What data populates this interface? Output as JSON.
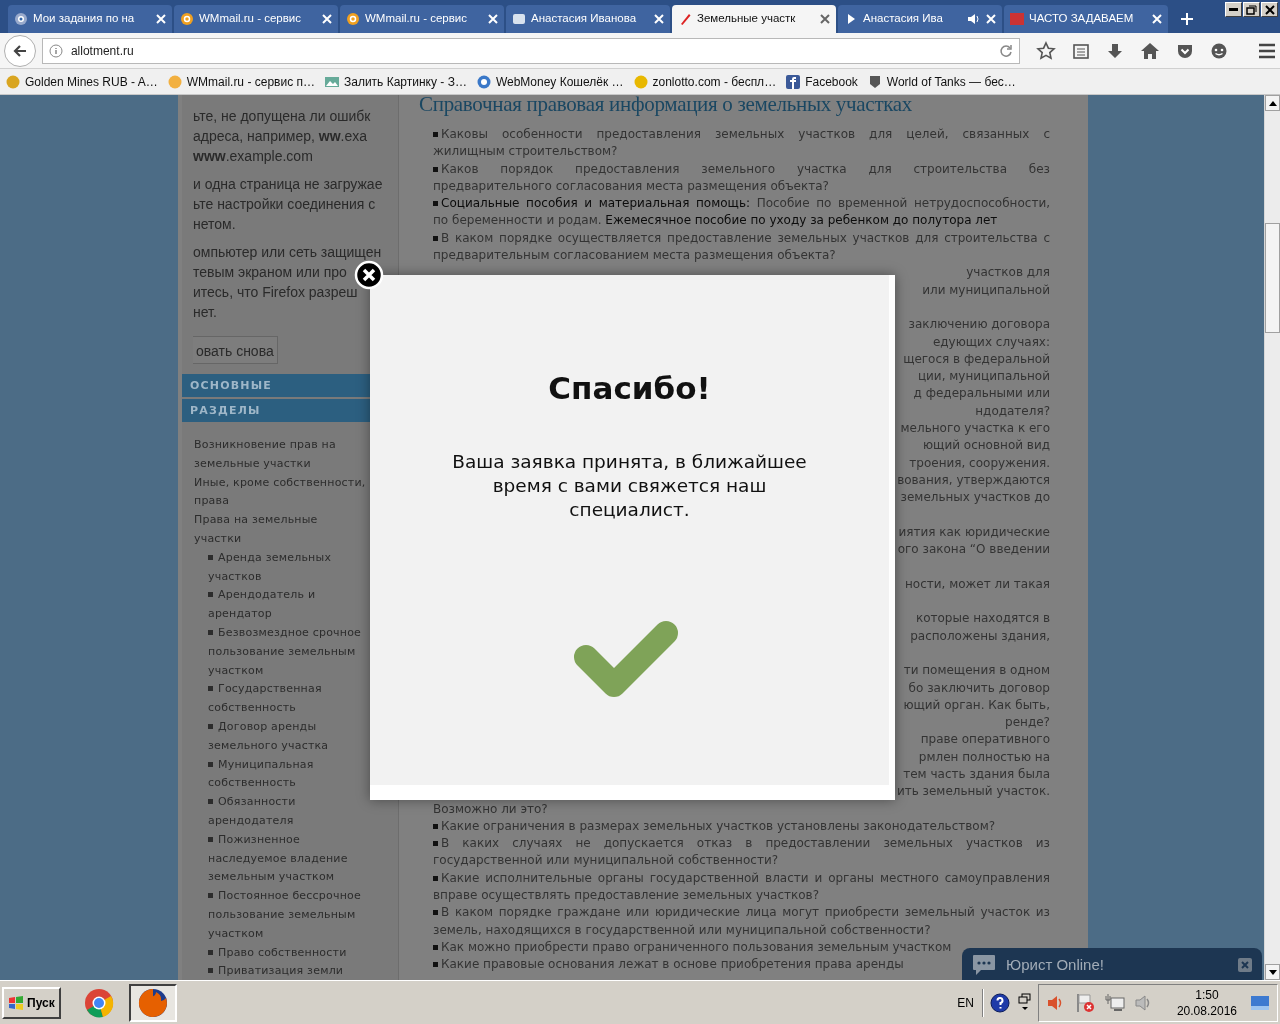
{
  "browser": {
    "tabs": [
      {
        "title": "Мои задания по на",
        "selected": false,
        "audio": false
      },
      {
        "title": "WMmail.ru - сервис",
        "selected": false,
        "audio": false
      },
      {
        "title": "WMmail.ru - сервис",
        "selected": false,
        "audio": false
      },
      {
        "title": "Анастасия Иванова",
        "selected": false,
        "audio": false
      },
      {
        "title": "Земельные участк",
        "selected": true,
        "audio": false
      },
      {
        "title": "Анастасия Ива",
        "selected": false,
        "audio": true
      },
      {
        "title": "ЧАСТО ЗАДАВАЕМ",
        "selected": false,
        "audio": false
      }
    ],
    "address": "allotment.ru",
    "bookmarks": [
      "Golden Mines RUB - A…",
      "WMmail.ru - сервис п…",
      "Залить Картинку - З…",
      "WebMoney Кошелёк …",
      "zonlotto.com - беспл…",
      "Facebook",
      "World of Tanks — бес…"
    ]
  },
  "page": {
    "error_lines": [
      "ьте, не допущена ли ошибк",
      "адреса, например, **ww**.exa",
      "**www**.example.com",
      "и одна страница не загружае",
      "ьте настройки соединения с",
      "нетом.",
      "омпьютер или сеть защищен",
      "тевым экраном или про",
      "итесь, что Firefox разреш",
      "нет."
    ],
    "retry_button": "овать снова",
    "sidebar": {
      "headings": [
        "ОСНОВНЫЕ",
        "РАЗДЕЛЫ"
      ],
      "items": [
        {
          "label": "Возникновение прав на земельные участки"
        },
        {
          "label": "Иные, кроме собственности, права"
        },
        {
          "label": "Права на земельные участки",
          "children": [
            {
              "label": "Аренда земельных участков"
            },
            {
              "label": "Арендодатель и арендатор"
            },
            {
              "label": "Безвозмездное срочное пользование земельным участком"
            },
            {
              "label": "Государственная собственность"
            },
            {
              "label": "Договор аренды земельного участка"
            },
            {
              "label": "Муниципальная собственность"
            },
            {
              "label": "Обязанности арендодателя"
            },
            {
              "label": "Пожизненное наследуемое владение земельным участком"
            },
            {
              "label": "Постоянное бессрочное пользование земельным участком"
            },
            {
              "label": "Право собственности"
            },
            {
              "label": "Приватизация земли"
            }
          ]
        }
      ]
    },
    "article": {
      "title": "Справочная правовая информация о земельных участках",
      "lines": [
        {
          "kind": "line",
          "text": "Каковы особенности предоставления земельных участков для целей, связанных с",
          "bullet": true,
          "justified": true
        },
        {
          "kind": "line",
          "text": "жилищным строительством?",
          "bullet": false,
          "justified": false
        },
        {
          "kind": "line",
          "text": "Каков порядок предоставления земельного участка для строительства без",
          "bullet": true,
          "justified": true
        },
        {
          "kind": "line",
          "text": "предварительного согласования места размещения объекта?",
          "bullet": false,
          "justified": false
        },
        {
          "kind": "line",
          "parts": [
            {
              "text": "Социальные пособия и материальная помощь:",
              "link": true
            },
            {
              "text": " Пособие по временной нетрудоспособности,",
              "link": false
            }
          ],
          "bullet": true,
          "justified": true
        },
        {
          "kind": "line",
          "parts": [
            {
              "text": "по беременности и родам. ",
              "link": false
            },
            {
              "text": "Ежемесячное пособие по уходу за ребенком до полутора лет",
              "link": true
            }
          ],
          "bullet": false,
          "justified": false
        },
        {
          "kind": "line",
          "text": "В каком порядке осуществляется предоставление земельных участков для строительства с",
          "bullet": true,
          "justified": true
        },
        {
          "kind": "line",
          "text": "предварительным согласованием места размещения объекта?",
          "bullet": false,
          "justified": false
        },
        {
          "kind": "fragment",
          "text": "участков для"
        },
        {
          "kind": "fragment",
          "text": "или муниципальной"
        },
        {
          "kind": "fragment",
          "text": "заключению договора",
          "gap_before": true
        },
        {
          "kind": "fragment",
          "text": "едующих случаях:"
        },
        {
          "kind": "fragment",
          "text": "щегося в федеральной"
        },
        {
          "kind": "fragment",
          "text": "ции, муниципальной"
        },
        {
          "kind": "fragment",
          "text": "д федеральными или"
        },
        {
          "kind": "fragment",
          "text": "ндодателя?"
        },
        {
          "kind": "fragment",
          "text": "мельного участка к его"
        },
        {
          "kind": "fragment",
          "text": "ющий основной вид"
        },
        {
          "kind": "fragment",
          "text": "троения, сооружения."
        },
        {
          "kind": "fragment",
          "text": "вования, утверждаются"
        },
        {
          "kind": "fragment",
          "text": "земельных участков до"
        },
        {
          "kind": "fragment",
          "text": "иятия как юридические",
          "gap_before": true
        },
        {
          "kind": "fragment",
          "text": "ого закона “О введении"
        },
        {
          "kind": "fragment",
          "text": "ности, может ли такая",
          "gap_before": true
        },
        {
          "kind": "fragment",
          "text": "которые находятся в",
          "gap_before": true
        },
        {
          "kind": "fragment",
          "text": "расположены здания,"
        },
        {
          "kind": "fragment",
          "text": "ти помещения в одном",
          "gap_before": true
        },
        {
          "kind": "fragment",
          "text": "бо заключить договор"
        },
        {
          "kind": "fragment",
          "text": "ющий орган. Как быть,"
        },
        {
          "kind": "fragment",
          "text": "ренде?"
        },
        {
          "kind": "fragment",
          "text": "праве оперативного"
        },
        {
          "kind": "fragment",
          "text": "рмлен полностью на"
        },
        {
          "kind": "fragment",
          "text": "тем часть здания была"
        },
        {
          "kind": "fragment",
          "text": "ить земельный участок."
        },
        {
          "kind": "line",
          "text": "Возможно ли это?",
          "bullet": false,
          "justified": false
        },
        {
          "kind": "line",
          "text": "Какие ограничения в размерах земельных участков установлены законодательством?",
          "bullet": true,
          "justified": false
        },
        {
          "kind": "line",
          "text": "В каких случаях не допускается отказ в предоставлении земельных участков из",
          "bullet": true,
          "justified": true
        },
        {
          "kind": "line",
          "text": "государственной или муниципальной собственности?",
          "bullet": false,
          "justified": false
        },
        {
          "kind": "line",
          "text": "Какие исполнительные органы государственной власти и органы местного самоуправления",
          "bullet": true,
          "justified": true
        },
        {
          "kind": "line",
          "text": "вправе осуществлять предоставление земельных участков?",
          "bullet": false,
          "justified": false
        },
        {
          "kind": "line",
          "text": "В каком порядке граждане или юридические лица могут приобрести земельный участок из",
          "bullet": true,
          "justified": true
        },
        {
          "kind": "line",
          "text": "земель, находящихся в государственной или муниципальной собственности?",
          "bullet": false,
          "justified": false
        },
        {
          "kind": "line",
          "text": "Как можно приобрести право ограниченного пользования земельным участком",
          "bullet": true,
          "justified": false
        },
        {
          "kind": "line",
          "text": "Какие правовые основания лежат в основе приобретения права аренды",
          "bullet": true,
          "justified": false
        }
      ]
    },
    "modal": {
      "title": "Спасибо!",
      "message": "Ваша заявка принята, в ближайшее время с вами свяжется наш специалист."
    },
    "chat": {
      "label": "Юрист Online!"
    }
  },
  "taskbar": {
    "start": "Пуск",
    "apps": [
      {
        "selected": false
      },
      {
        "selected": true
      }
    ],
    "language": "EN",
    "time": "1:50",
    "date": "20.08.2016"
  }
}
